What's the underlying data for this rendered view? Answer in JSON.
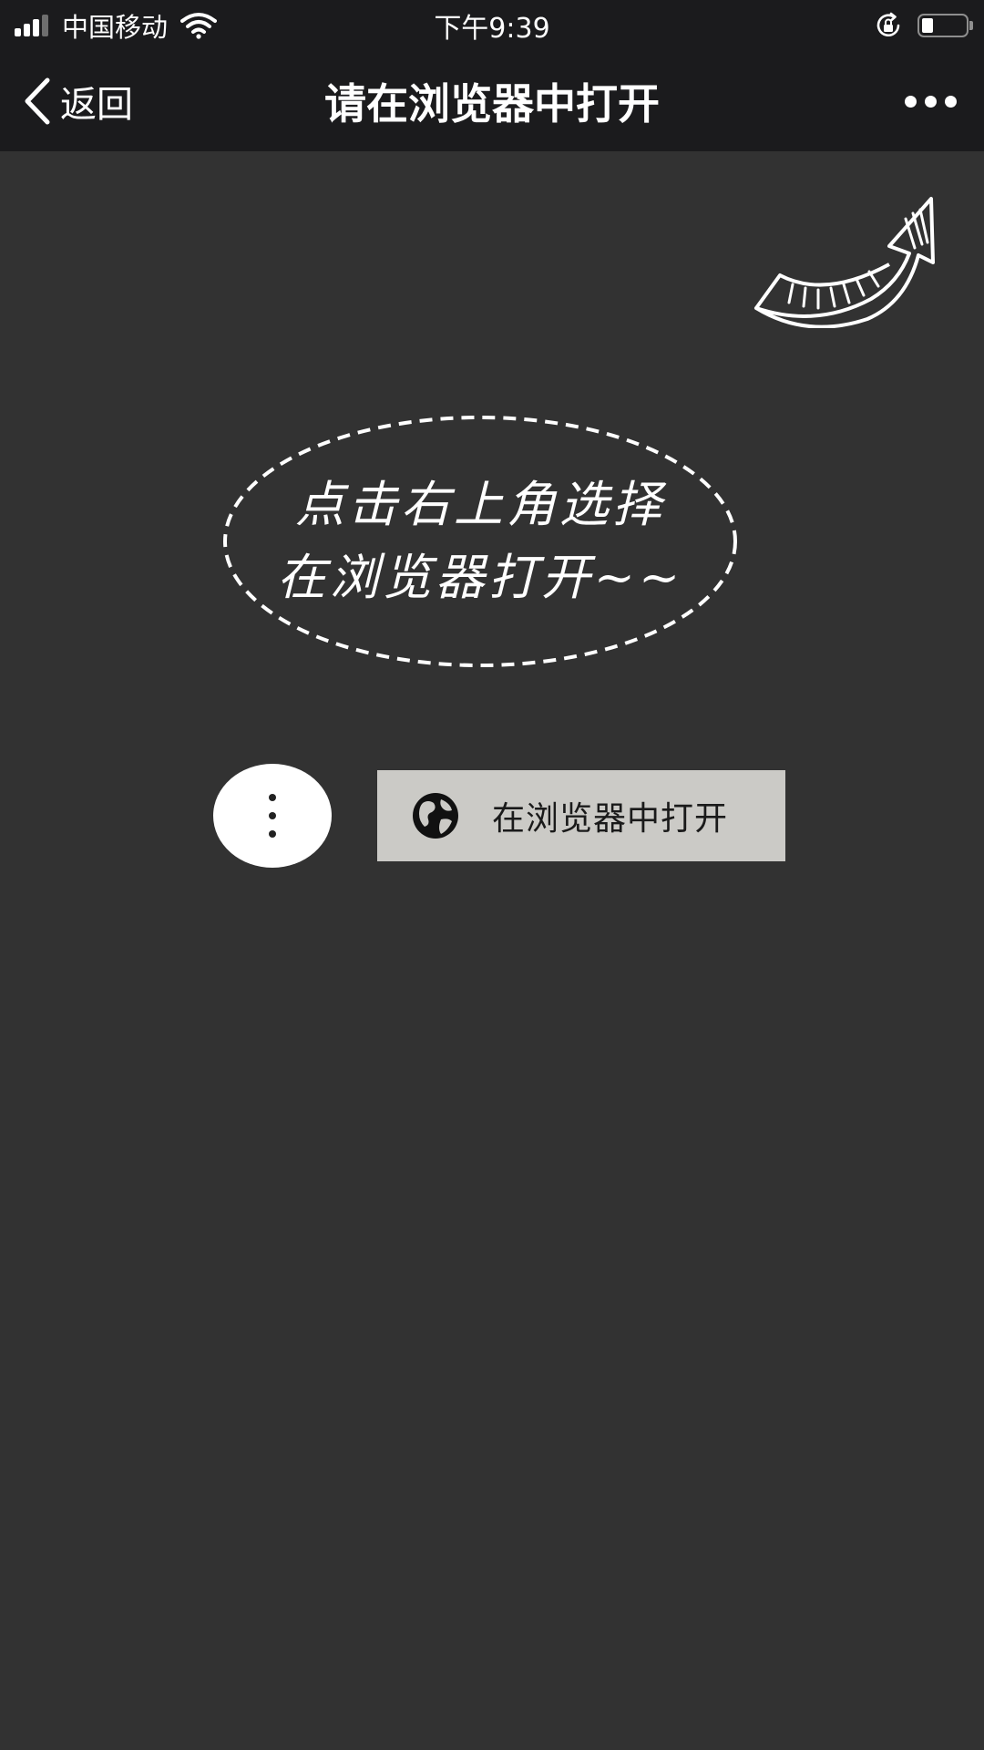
{
  "status_bar": {
    "carrier": "中国移动",
    "time": "下午9:39",
    "signal_icon": "signal-bars-icon",
    "wifi_icon": "wifi-icon",
    "orientation_lock_icon": "orientation-lock-icon",
    "battery_icon": "battery-icon",
    "battery_level": 0.25
  },
  "nav_bar": {
    "back_label": "返回",
    "back_icon": "chevron-left-icon",
    "title": "请在浏览器中打开",
    "more_icon": "more-dots-icon"
  },
  "instruction": {
    "line1": "点击右上角选择",
    "line2": "在浏览器打开~~",
    "arrow_icon": "curved-arrow-icon"
  },
  "hint": {
    "dots_icon": "vertical-dots-icon",
    "button_label": "在浏览器中打开",
    "button_icon": "globe-icon"
  },
  "colors": {
    "background": "#323232",
    "bar_background": "#1b1b1d",
    "button_background": "#cbcac6"
  }
}
